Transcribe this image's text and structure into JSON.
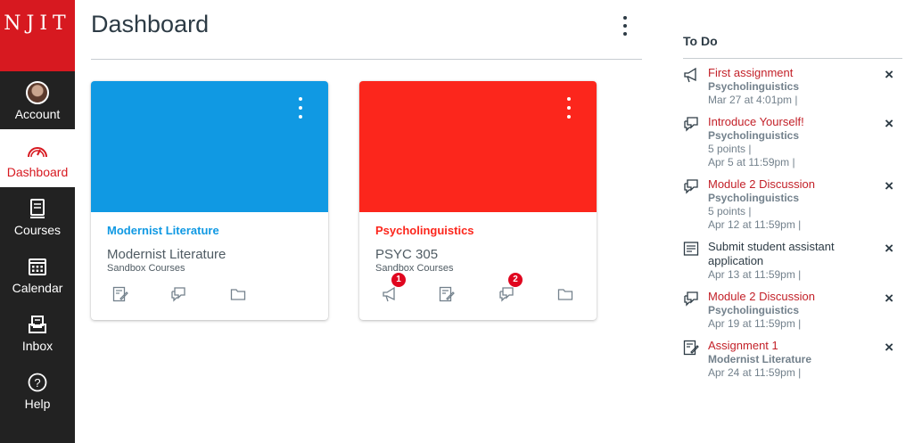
{
  "nav": {
    "logo_text": "NJIT",
    "logo_color": "#d71920",
    "items": [
      {
        "label": "Account",
        "icon": "avatar"
      },
      {
        "label": "Dashboard",
        "icon": "dashboard-icon",
        "active": true
      },
      {
        "label": "Courses",
        "icon": "courses-icon"
      },
      {
        "label": "Calendar",
        "icon": "calendar-icon"
      },
      {
        "label": "Inbox",
        "icon": "inbox-icon"
      },
      {
        "label": "Help",
        "icon": "help-icon"
      }
    ]
  },
  "header": {
    "title": "Dashboard"
  },
  "cards": [
    {
      "name": "Modernist Literature",
      "code": "Modernist Literature",
      "term": "Sandbox Courses",
      "color": "#1099e3",
      "icons": [
        "assignments-icon",
        "discussions-icon",
        "files-icon"
      ]
    },
    {
      "name": "Psycholinguistics",
      "code": "PSYC 305",
      "term": "Sandbox Courses",
      "color": "#fc261c",
      "icons": [
        "announcements-icon",
        "assignments-icon",
        "discussions-icon",
        "files-icon"
      ],
      "badges": {
        "announcements": "1",
        "discussions": "2"
      }
    }
  ],
  "todo": {
    "title": "To Do",
    "items": [
      {
        "icon": "announcement-icon",
        "title": "First assignment",
        "course": "Psycholinguistics",
        "points": "",
        "due": "Mar 27 at 4:01pm  |"
      },
      {
        "icon": "discussion-icon",
        "title": "Introduce Yourself!",
        "course": "Psycholinguistics",
        "points": "5 points  |",
        "due": "Apr 5 at 11:59pm  |"
      },
      {
        "icon": "discussion-icon",
        "title": "Module 2 Discussion",
        "course": "Psycholinguistics",
        "points": "5 points  |",
        "due": "Apr 12 at 11:59pm  |"
      },
      {
        "icon": "note-icon",
        "title": "Submit student assistant application",
        "course": "",
        "points": "",
        "due": "Apr 13 at 11:59pm  |"
      },
      {
        "icon": "discussion-icon",
        "title": "Module 2 Discussion",
        "course": "Psycholinguistics",
        "points": "",
        "due": "Apr 19 at 11:59pm  |"
      },
      {
        "icon": "assignment-icon",
        "title": "Assignment 1",
        "course": "Modernist Literature",
        "points": "",
        "due": "Apr 24 at 11:59pm  |"
      }
    ],
    "dismiss_label": "×"
  },
  "colors": {
    "link_red": "#c32129",
    "text": "#2d3b45",
    "muted": "#73818c"
  }
}
